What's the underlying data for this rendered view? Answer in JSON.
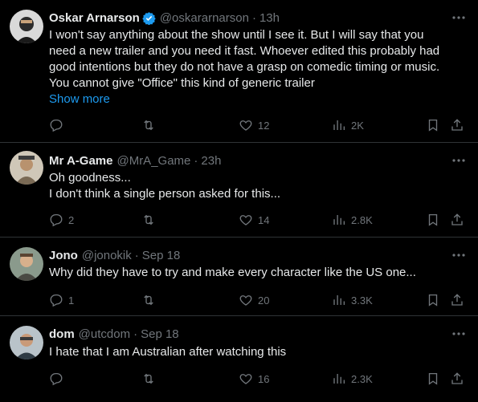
{
  "tweets": [
    {
      "name": "Oskar Arnarson",
      "verified": true,
      "handle": "@oskararnarson",
      "time": "13h",
      "lines": [
        "I won't say anything about the show until I see it. But I will say that you",
        "need a new trailer and you need it fast. Whoever edited this probably had",
        "good intentions but they do not have a grasp on comedic timing or music.",
        "You cannot give \"Office\" this kind of generic trailer"
      ],
      "show_more": "Show more",
      "replies": "",
      "retweets": "",
      "likes": "12",
      "views": "2K"
    },
    {
      "name": "Mr A-Game",
      "verified": false,
      "handle": "@MrA_Game",
      "time": "23h",
      "lines": [
        "Oh goodness...",
        "I don't think a single person asked for this..."
      ],
      "replies": "2",
      "retweets": "",
      "likes": "14",
      "views": "2.8K"
    },
    {
      "name": "Jono",
      "verified": false,
      "handle": "@jonokik",
      "time": "Sep 18",
      "lines": [
        "Why did they have to try and make every character like the US one..."
      ],
      "replies": "1",
      "retweets": "",
      "likes": "20",
      "views": "3.3K"
    },
    {
      "name": "dom",
      "verified": false,
      "handle": "@utcdom",
      "time": "Sep 18",
      "lines": [
        "I hate that I am Australian after watching this"
      ],
      "replies": "",
      "retweets": "",
      "likes": "16",
      "views": "2.3K"
    }
  ],
  "colors": {
    "background": "#000000",
    "text": "#e7e9ea",
    "muted": "#71767b",
    "accent": "#1d9bf0",
    "divider": "#2f3336"
  },
  "icons": [
    "more-icon",
    "verified-icon",
    "reply-icon",
    "retweet-icon",
    "like-icon",
    "views-icon",
    "bookmark-icon",
    "share-icon"
  ]
}
